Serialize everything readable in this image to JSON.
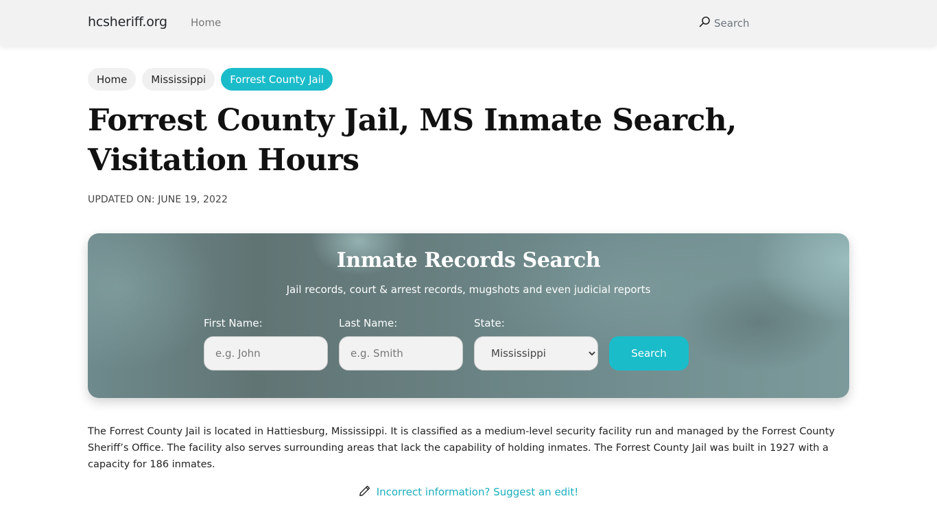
{
  "navbar": {
    "brand": "hcsheriff.org",
    "links": [
      {
        "label": "Home"
      }
    ],
    "search_label": "Search",
    "search_icon": "search-icon"
  },
  "breadcrumb": [
    {
      "label": "Home",
      "active": false
    },
    {
      "label": "Mississippi",
      "active": false
    },
    {
      "label": "Forrest County Jail",
      "active": true
    }
  ],
  "page": {
    "title": "Forrest County Jail, MS Inmate Search, Visitation Hours",
    "updated": "UPDATED ON: JUNE 19, 2022"
  },
  "search_card": {
    "title": "Inmate Records Search",
    "subtitle": "Jail records, court & arrest records, mugshots and even judicial reports",
    "first_name": {
      "label": "First Name:",
      "placeholder": "e.g. John",
      "value": ""
    },
    "last_name": {
      "label": "Last Name:",
      "placeholder": "e.g. Smith",
      "value": ""
    },
    "state": {
      "label": "State:",
      "selected": "Mississippi"
    },
    "submit_label": "Search"
  },
  "description": "The Forrest County Jail is located in Hattiesburg, Mississippi. It is classified as a medium-level security facility run and managed by the Forrest County Sheriff’s Office. The facility also serves surrounding areas that lack the capability of holding inmates. The Forrest County Jail was built in 1927 with a capacity for 186 inmates.",
  "suggest_edit": {
    "icon": "pencil-icon",
    "label": "Incorrect information? Suggest an edit!"
  },
  "colors": {
    "accent": "#1bbcca",
    "navbar_bg": "#f2f2f2",
    "link": "#1aafbd"
  }
}
